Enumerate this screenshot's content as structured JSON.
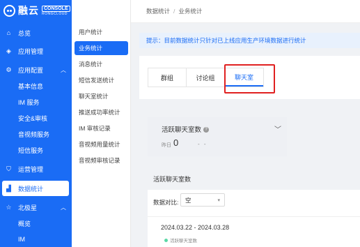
{
  "brand": {
    "name": "融云",
    "console": "CONSOLE",
    "sub": "RONGCLOUD"
  },
  "sidebar": {
    "items": [
      {
        "label": "总览",
        "icon": "home-icon"
      },
      {
        "label": "应用管理",
        "icon": "layers-icon"
      },
      {
        "label": "应用配置",
        "icon": "sliders-icon",
        "chevron": "^"
      },
      {
        "label": "基本信息"
      },
      {
        "label": "IM 服务"
      },
      {
        "label": "安全&审核"
      },
      {
        "label": "音视频服务"
      },
      {
        "label": "短信服务"
      },
      {
        "label": "运营管理",
        "icon": "shield-icon"
      },
      {
        "label": "数据统计",
        "icon": "chart-icon"
      },
      {
        "label": "北极星",
        "icon": "star-icon",
        "chevron": "^"
      },
      {
        "label": "概览"
      },
      {
        "label": "IM"
      }
    ]
  },
  "subnav": {
    "items": [
      "用户统计",
      "业务统计",
      "消息统计",
      "短信发送统计",
      "聊天室统计",
      "推送成功率统计",
      "IM 审核记录",
      "音视频用量统计",
      "音视频审核记录"
    ]
  },
  "breadcrumb": {
    "root": "数据统计",
    "sep": "/",
    "current": "业务统计"
  },
  "notice": "提示：目前数据统计只针对已上线应用生产环境数据进行统计",
  "tabs": [
    "群组",
    "讨论组",
    "聊天室"
  ],
  "stat": {
    "title": "活跃聊天室数",
    "yday_label": "昨日",
    "value": "0",
    "dash": "- -"
  },
  "chart": {
    "title": "活跃聊天室数",
    "compare_label": "数据对比:",
    "compare_value": "空",
    "date_range": "2024.03.22 - 2024.03.28",
    "legend": "活跃聊天室数"
  },
  "colors": {
    "primary": "#1a6cf5",
    "highlight": "#e02020",
    "legend": "#5ad8a6"
  }
}
